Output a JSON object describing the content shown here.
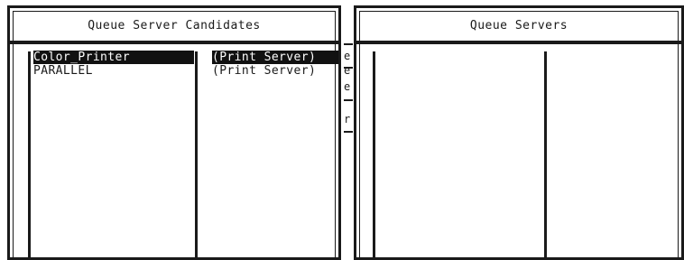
{
  "left_panel": {
    "title": "Queue Server Candidates",
    "items": [
      {
        "name": "Color_Printer",
        "type": "(Print Server)",
        "selected": true
      },
      {
        "name": "PARALLEL",
        "type": "(Print Server)",
        "selected": false
      }
    ]
  },
  "background_sliver": {
    "chars": [
      "e",
      "e",
      "e",
      "r"
    ]
  },
  "right_panel": {
    "title": "Queue Servers"
  }
}
